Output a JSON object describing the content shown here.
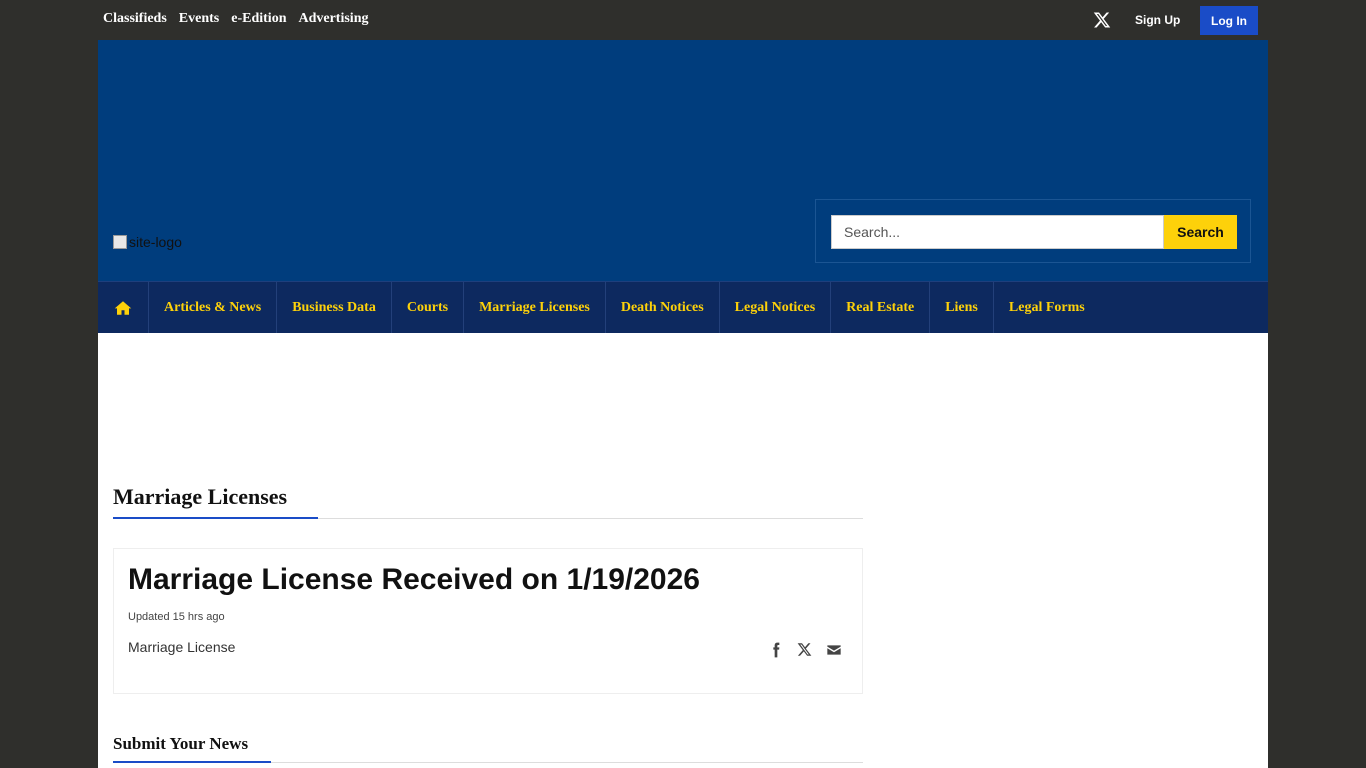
{
  "topbar": {
    "links": [
      "Classifieds",
      "Events",
      "e-Edition",
      "Advertising"
    ],
    "signup": "Sign Up",
    "login": "Log In"
  },
  "header": {
    "logo_alt": "site-logo",
    "search": {
      "placeholder": "Search...",
      "button": "Search"
    }
  },
  "nav": {
    "items": [
      "Articles & News",
      "Business Data",
      "Courts",
      "Marriage Licenses",
      "Death Notices",
      "Legal Notices",
      "Real Estate",
      "Liens",
      "Legal Forms"
    ]
  },
  "main": {
    "section_title": "Marriage Licenses",
    "article": {
      "title": "Marriage License Received on 1/19/2026",
      "updated": "Updated 15 hrs ago",
      "summary": "Marriage License"
    },
    "submit_title": "Submit Your News"
  },
  "colors": {
    "page_bg": "#2f2f2c",
    "header_bg": "#003d7d",
    "nav_bg": "#0d295f",
    "accent_yellow": "#fdd10a",
    "accent_blue": "#1a4cc7"
  }
}
